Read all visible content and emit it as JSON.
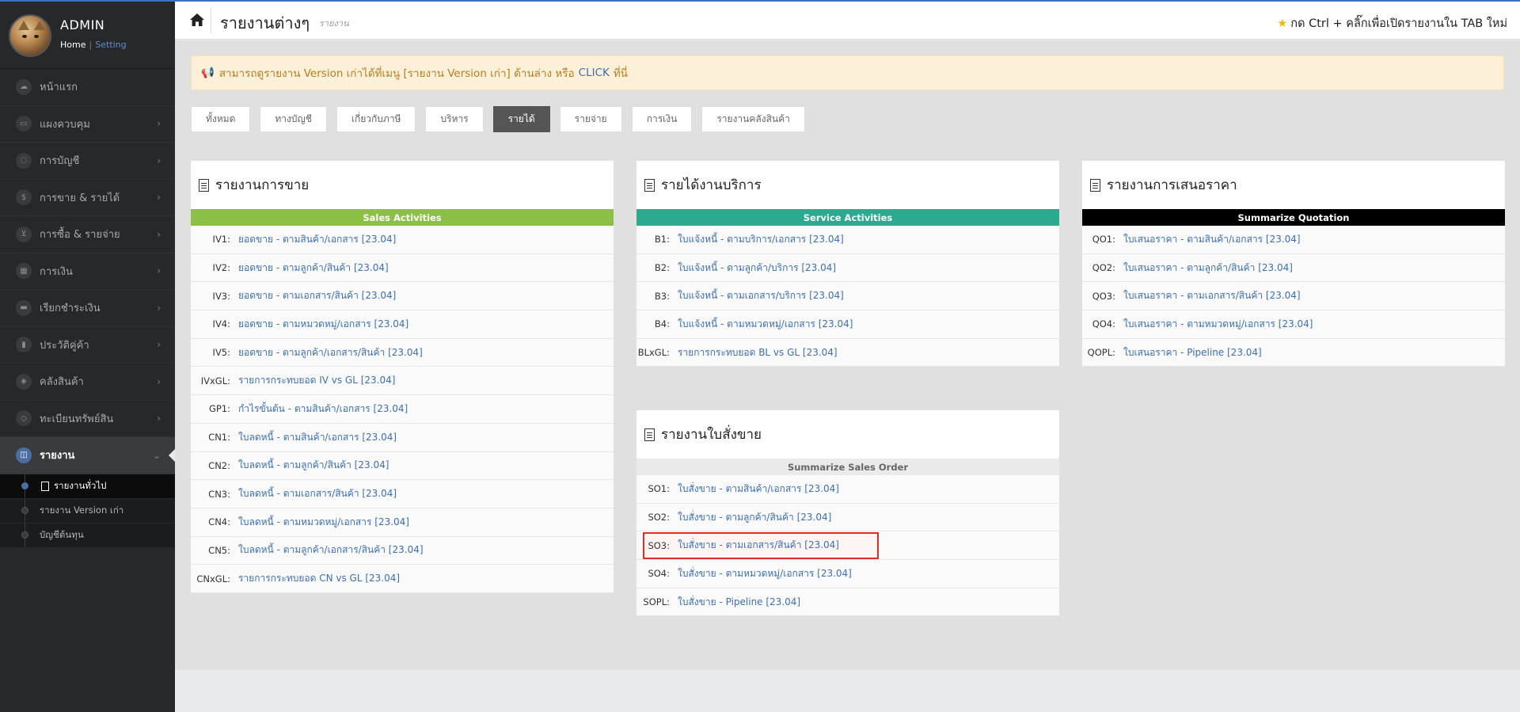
{
  "profile": {
    "name": "ADMIN",
    "home_link": "Home",
    "separator": "|",
    "setting_link": "Setting"
  },
  "sidebar": {
    "items": [
      {
        "label": "หน้าแรก",
        "icon": "cloud-icon",
        "arrow": false
      },
      {
        "label": "แผงควบคุม",
        "icon": "monitor-icon",
        "arrow": true
      },
      {
        "label": "การบัญชี",
        "icon": "speech-icon",
        "arrow": true
      },
      {
        "label": "การขาย & รายได้",
        "icon": "dollar-icon",
        "arrow": true
      },
      {
        "label": "การซื้อ & รายจ่าย",
        "icon": "cart-icon",
        "arrow": true
      },
      {
        "label": "การเงิน",
        "icon": "calendar-icon",
        "arrow": true
      },
      {
        "label": "เรียกชำระเงิน",
        "icon": "credit-card-icon",
        "arrow": true
      },
      {
        "label": "ประวัติคู่ค้า",
        "icon": "book-icon",
        "arrow": true
      },
      {
        "label": "คลังสินค้า",
        "icon": "cubes-icon",
        "arrow": true
      },
      {
        "label": "ทะเบียนทรัพย์สิน",
        "icon": "diamond-icon",
        "arrow": true
      },
      {
        "label": "รายงาน",
        "icon": "reports-icon",
        "arrow": true
      }
    ],
    "submenu": [
      {
        "label": "รายงานทั่วไป"
      },
      {
        "label": "รายงาน Version เก่า"
      },
      {
        "label": "บัญชีต้นทุน"
      }
    ]
  },
  "header": {
    "title": "รายงานต่างๆ",
    "subtitle": "รายงาน",
    "hint": "กด Ctrl + คลิ๊กเพื่อเปิดรายงานใน TAB ใหม่"
  },
  "notice": {
    "text": "สามารถดูรายงาน Version เก่าได้ที่เมนู [รายงาน Version เก่า] ด้านล่าง หรือ",
    "click": "CLICK",
    "suffix": "ที่นี่"
  },
  "filters": [
    "ทั้งหมด",
    "ทางบัญชี",
    "เกี่ยวกับภาษี",
    "บริหาร",
    "รายได้",
    "รายจ่าย",
    "การเงิน",
    "รายงานคลังสินค้า"
  ],
  "colors": {
    "sales_band": "#8cbf45",
    "service_band": "#2baa8f",
    "quotation_band": "#000000",
    "order_band": "#eaeaea",
    "link": "#3b6fb6",
    "highlight": "#e02b2b"
  },
  "cards": {
    "sales": {
      "title": "รายงานการขาย",
      "band": "Sales Activities",
      "rows": [
        {
          "code": "IV1:",
          "label": "ยอดขาย - ตามสินค้า/เอกสาร [23.04]"
        },
        {
          "code": "IV2:",
          "label": "ยอดขาย - ตามลูกค้า/สินค้า [23.04]"
        },
        {
          "code": "IV3:",
          "label": "ยอดขาย - ตามเอกสาร/สินค้า [23.04]"
        },
        {
          "code": "IV4:",
          "label": "ยอดขาย - ตามหมวดหมู่/เอกสาร [23.04]"
        },
        {
          "code": "IV5:",
          "label": "ยอดขาย - ตามลูกค้า/เอกสาร/สินค้า [23.04]"
        },
        {
          "code": "IVxGL:",
          "label": "รายการกระทบยอด IV vs GL [23.04]"
        },
        {
          "code": "GP1:",
          "label": "กำไรขั้นต้น - ตามสินค้า/เอกสาร [23.04]"
        },
        {
          "code": "CN1:",
          "label": "ใบลดหนี้ - ตามสินค้า/เอกสาร [23.04]"
        },
        {
          "code": "CN2:",
          "label": "ใบลดหนี้ - ตามลูกค้า/สินค้า [23.04]"
        },
        {
          "code": "CN3:",
          "label": "ใบลดหนี้ - ตามเอกสาร/สินค้า [23.04]"
        },
        {
          "code": "CN4:",
          "label": "ใบลดหนี้ - ตามหมวดหมู่/เอกสาร [23.04]"
        },
        {
          "code": "CN5:",
          "label": "ใบลดหนี้ - ตามลูกค้า/เอกสาร/สินค้า [23.04]"
        },
        {
          "code": "CNxGL:",
          "label": "รายการกระทบยอด CN vs GL [23.04]"
        }
      ]
    },
    "service": {
      "title": "รายได้งานบริการ",
      "band": "Service Activities",
      "rows": [
        {
          "code": "B1:",
          "label": "ใบแจ้งหนี้ - ตามบริการ/เอกสาร [23.04]"
        },
        {
          "code": "B2:",
          "label": "ใบแจ้งหนี้ - ตามลูกค้า/บริการ [23.04]"
        },
        {
          "code": "B3:",
          "label": "ใบแจ้งหนี้ - ตามเอกสาร/บริการ [23.04]"
        },
        {
          "code": "B4:",
          "label": "ใบแจ้งหนี้ - ตามหมวดหมู่/เอกสาร [23.04]"
        },
        {
          "code": "BLxGL:",
          "label": "รายการกระทบยอด BL vs GL [23.04]"
        }
      ]
    },
    "quotation": {
      "title": "รายงานการเสนอราคา",
      "band": "Summarize Quotation",
      "rows": [
        {
          "code": "QO1:",
          "label": "ใบเสนอราคา - ตามสินค้า/เอกสาร [23.04]"
        },
        {
          "code": "QO2:",
          "label": "ใบเสนอราคา - ตามลูกค้า/สินค้า [23.04]"
        },
        {
          "code": "QO3:",
          "label": "ใบเสนอราคา - ตามเอกสาร/สินค้า [23.04]"
        },
        {
          "code": "QO4:",
          "label": "ใบเสนอราคา - ตามหมวดหมู่/เอกสาร [23.04]"
        },
        {
          "code": "QOPL:",
          "label": "ใบเสนอราคา - Pipeline [23.04]"
        }
      ]
    },
    "order": {
      "title": "รายงานใบสั่งขาย",
      "band": "Summarize Sales Order",
      "rows": [
        {
          "code": "SO1:",
          "label": "ใบสั่งขาย - ตามสินค้า/เอกสาร [23.04]"
        },
        {
          "code": "SO2:",
          "label": "ใบสั่งขาย - ตามลูกค้า/สินค้า [23.04]"
        },
        {
          "code": "SO3:",
          "label": "ใบสั่งขาย - ตามเอกสาร/สินค้า [23.04]"
        },
        {
          "code": "SO4:",
          "label": "ใบสั่งขาย - ตามหมวดหมู่/เอกสาร [23.04]"
        },
        {
          "code": "SOPL:",
          "label": "ใบสั่งขาย - Pipeline [23.04]"
        }
      ]
    }
  }
}
